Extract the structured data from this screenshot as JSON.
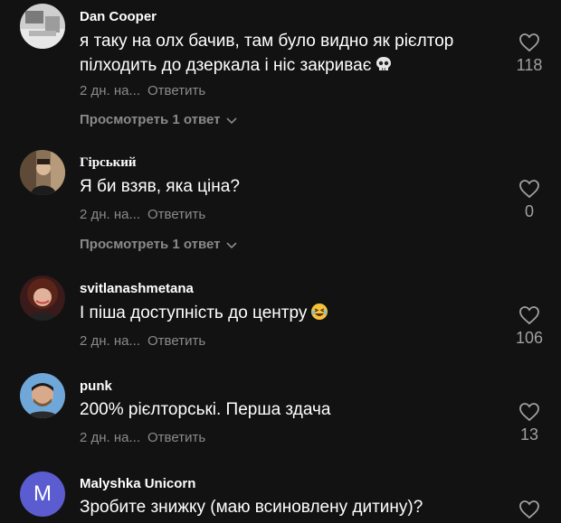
{
  "comments": [
    {
      "author": "Dan Cooper",
      "text_line1": "я таку на олх бачив, там було видно як рієлтор",
      "text_line2": "пілходить до дзеркала і ніс закриває",
      "emoji": "skull-emoji",
      "time": "2 дн. на...",
      "reply": "Ответить",
      "likes": "118",
      "view_replies": "Просмотреть 1 ответ"
    },
    {
      "author": "Гірський",
      "text": "Я би взяв, яка ціна?",
      "time": "2 дн. на...",
      "reply": "Ответить",
      "likes": "0",
      "view_replies": "Просмотреть 1 ответ"
    },
    {
      "author": "svitlanashmetana",
      "text": "І піша доступність до центру",
      "emoji": "laughing-emoji",
      "time": "2 дн. на...",
      "reply": "Ответить",
      "likes": "106"
    },
    {
      "author": "punk",
      "text": "200% рієлторські. Перша здача",
      "time": "2 дн. на...",
      "reply": "Ответить",
      "likes": "13"
    },
    {
      "author": "Malyshka Unicorn",
      "avatar_letter": "M",
      "text": "Зробите знижку (маю всиновлену дитину)?"
    }
  ],
  "colors": {
    "background": "#121212",
    "text": "#ffffff",
    "meta": "#8a8a8a",
    "avatar_letter_bg": "#5b5ccf"
  }
}
